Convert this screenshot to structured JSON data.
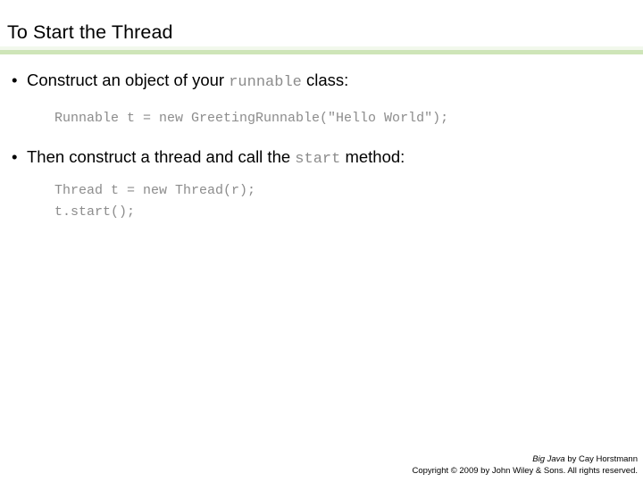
{
  "slide": {
    "title": "To Start the Thread",
    "accent_color": "#cee5b8",
    "code_color": "#8c8c8c",
    "text_color": "#000000",
    "background_color": "#ffffff",
    "bullet_glyph": "•"
  },
  "content": {
    "bullet_1": {
      "part_before": "Construct an object of your ",
      "code_term": "runnable",
      "part_after": " class:"
    },
    "code_1": {
      "lines": [
        "Runnable t = new GreetingRunnable(\"Hello World\");"
      ]
    },
    "bullet_2": {
      "part_before": "Then construct a thread and call the ",
      "code_term": "start",
      "part_after": " method:"
    },
    "code_2": {
      "lines": [
        "Thread t = new Thread(r);",
        "t.start();"
      ]
    }
  },
  "footer": {
    "book_title": "Big Java",
    "credit_rest": " by Cay Horstmann",
    "copyright": "Copyright © 2009 by John Wiley & Sons.  All rights reserved."
  }
}
